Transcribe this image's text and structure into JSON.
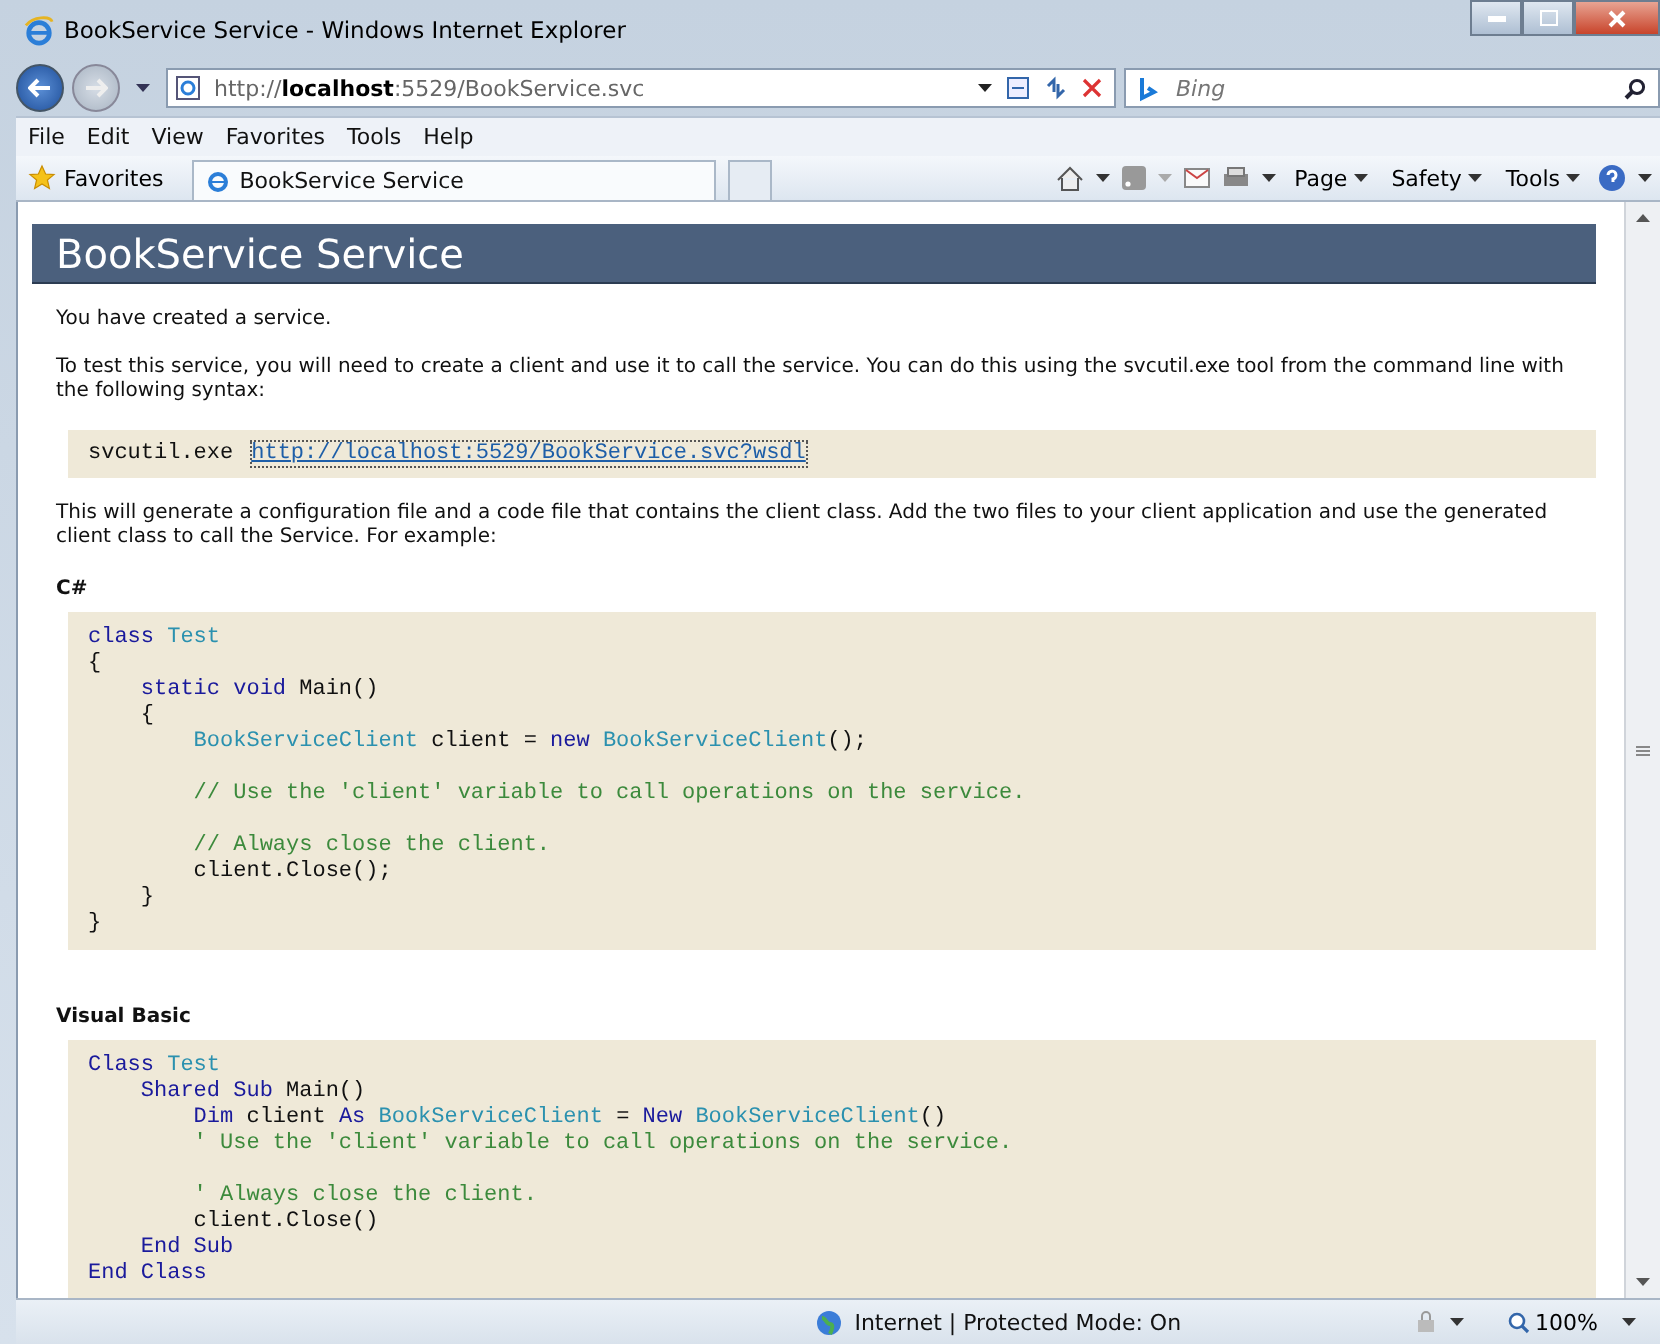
{
  "window": {
    "title": "BookService Service - Windows Internet Explorer"
  },
  "address_bar": {
    "url": "http://**localhost**:5529/BookService.svc"
  },
  "search": {
    "placeholder": "Bing"
  },
  "menu": [
    "File",
    "Edit",
    "View",
    "Favorites",
    "Tools",
    "Help"
  ],
  "favorites_bar": {
    "favorites": "Favorites",
    "tabs": [
      {
        "label": "BookService Service",
        "selected": true
      }
    ],
    "commands": [
      "Page",
      "Safety",
      "Tools"
    ]
  },
  "page": {
    "heading": "BookService Service",
    "intro": "You have created a service.",
    "instructions": "To test this service, you will need to create a client and use it to call the service. You can do this using the svcutil.exe tool from the command line with the following syntax:",
    "command": {
      "text": "svcutil.exe",
      "link": "http://localhost:5529/BookService.svc?wsdl"
    },
    "explanation": "This will generate a configuration file and a code file that contains the client class. Add the two files to your client application and use the generated client class to call the Service. For example:",
    "samples": [
      {
        "language": "C#",
        "lines": [
          {
            "kind": "code",
            "tokens": [
              {
                "kind": "kw",
                "text": "class "
              },
              {
                "kind": "type",
                "text": "Test"
              }
            ]
          },
          {
            "kind": "code",
            "tokens": [
              {
                "kind": "text",
                "text": "{"
              }
            ]
          },
          {
            "kind": "code",
            "tokens": [
              {
                "kind": "kw",
                "text": "    static void "
              },
              {
                "kind": "text",
                "text": "Main()"
              }
            ]
          },
          {
            "kind": "code",
            "tokens": [
              {
                "kind": "text",
                "text": "    {"
              }
            ]
          },
          {
            "kind": "code",
            "tokens": [
              {
                "kind": "type",
                "text": "        BookServiceClient"
              },
              {
                "kind": "text",
                "text": " client = "
              },
              {
                "kind": "kw",
                "text": "new "
              },
              {
                "kind": "type",
                "text": "BookServiceClient"
              },
              {
                "kind": "text",
                "text": "();"
              }
            ]
          },
          {
            "kind": "blank"
          },
          {
            "kind": "code",
            "tokens": [
              {
                "kind": "comment",
                "text": "        // Use the 'client' variable to call operations on the service."
              }
            ]
          },
          {
            "kind": "blank"
          },
          {
            "kind": "code",
            "tokens": [
              {
                "kind": "comment",
                "text": "        // Always close the client."
              }
            ]
          },
          {
            "kind": "code",
            "tokens": [
              {
                "kind": "text",
                "text": "        client.Close();"
              }
            ]
          },
          {
            "kind": "code",
            "tokens": [
              {
                "kind": "text",
                "text": "    }"
              }
            ]
          },
          {
            "kind": "code",
            "tokens": [
              {
                "kind": "text",
                "text": "}"
              }
            ]
          }
        ]
      },
      {
        "language": "Visual Basic",
        "lines": [
          {
            "kind": "code",
            "tokens": [
              {
                "kind": "kw",
                "text": "Class "
              },
              {
                "kind": "type",
                "text": "Test"
              }
            ]
          },
          {
            "kind": "code",
            "tokens": [
              {
                "kind": "kw",
                "text": "    Shared Sub "
              },
              {
                "kind": "text",
                "text": "Main()"
              }
            ]
          },
          {
            "kind": "code",
            "tokens": [
              {
                "kind": "kw",
                "text": "        Dim "
              },
              {
                "kind": "text",
                "text": "client "
              },
              {
                "kind": "kw",
                "text": "As "
              },
              {
                "kind": "type",
                "text": "BookServiceClient"
              },
              {
                "kind": "text",
                "text": " = "
              },
              {
                "kind": "kw",
                "text": "New "
              },
              {
                "kind": "type",
                "text": "BookServiceClient"
              },
              {
                "kind": "text",
                "text": "()"
              }
            ]
          },
          {
            "kind": "code",
            "tokens": [
              {
                "kind": "comment",
                "text": "        ' Use the 'client' variable to call operations on the service."
              }
            ]
          },
          {
            "kind": "blank"
          },
          {
            "kind": "code",
            "tokens": [
              {
                "kind": "comment",
                "text": "        ' Always close the client."
              }
            ]
          },
          {
            "kind": "code",
            "tokens": [
              {
                "kind": "text",
                "text": "        client.Close()"
              }
            ]
          },
          {
            "kind": "code",
            "tokens": [
              {
                "kind": "kw",
                "text": "    End Sub"
              }
            ]
          },
          {
            "kind": "code",
            "tokens": [
              {
                "kind": "kw",
                "text": "End Class"
              }
            ]
          }
        ]
      }
    ]
  },
  "status_bar": {
    "zone": "Internet | Protected Mode: On",
    "zoom": "100%"
  }
}
